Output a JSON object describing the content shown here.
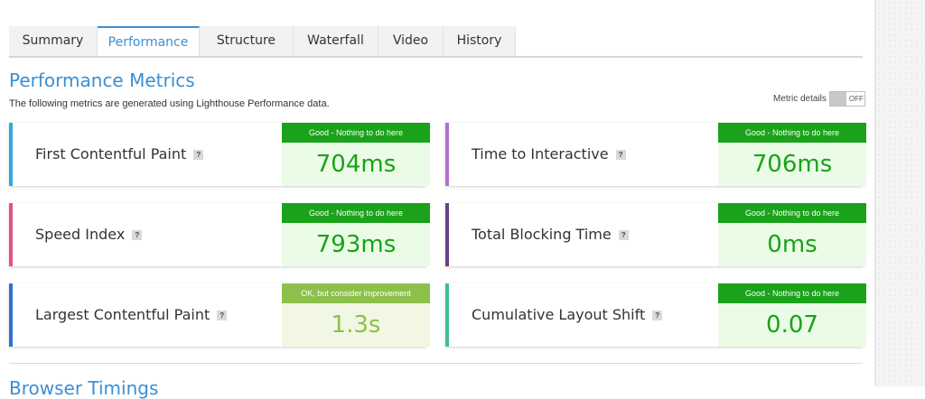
{
  "tabs": [
    {
      "label": "Summary",
      "active": false
    },
    {
      "label": "Performance",
      "active": true
    },
    {
      "label": "Structure",
      "active": false
    },
    {
      "label": "Waterfall",
      "active": false
    },
    {
      "label": "Video",
      "active": false
    },
    {
      "label": "History",
      "active": false
    }
  ],
  "section": {
    "title": "Performance Metrics",
    "subtitle": "The following metrics are generated using Lighthouse Performance data."
  },
  "metric_details": {
    "label": "Metric details",
    "state": "OFF"
  },
  "help_glyph": "?",
  "metrics": [
    {
      "label": "First Contentful Paint",
      "grade": "Good - Nothing to do here",
      "value": "704ms",
      "status": "good",
      "accent": "#2fa8e0"
    },
    {
      "label": "Time to Interactive",
      "grade": "Good - Nothing to do here",
      "value": "706ms",
      "status": "good",
      "accent": "#b36fd6"
    },
    {
      "label": "Speed Index",
      "grade": "Good - Nothing to do here",
      "value": "793ms",
      "status": "good",
      "accent": "#e6508a"
    },
    {
      "label": "Total Blocking Time",
      "grade": "Good - Nothing to do here",
      "value": "0ms",
      "status": "good",
      "accent": "#6d3d86"
    },
    {
      "label": "Largest Contentful Paint",
      "grade": "OK, but consider improvement",
      "value": "1.3s",
      "status": "ok",
      "accent": "#2f6fd6"
    },
    {
      "label": "Cumulative Layout Shift",
      "grade": "Good - Nothing to do here",
      "value": "0.07",
      "status": "good",
      "accent": "#3cc08d"
    }
  ],
  "colors": {
    "good": "#1aa21a",
    "ok": "#8dc04a",
    "brand": "#3a8fd4"
  },
  "next_section": {
    "title": "Browser Timings"
  }
}
